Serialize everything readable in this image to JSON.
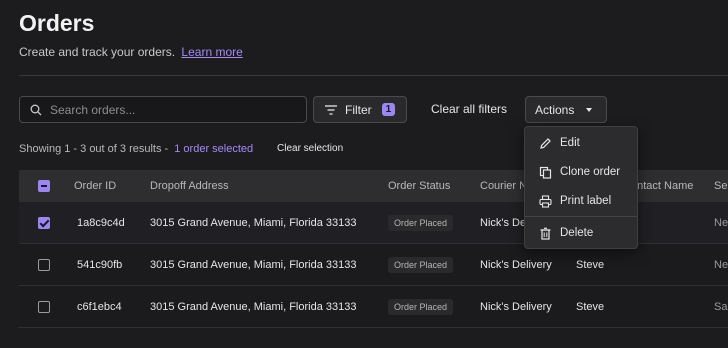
{
  "page": {
    "title": "Orders",
    "subtitle": "Create and track your orders.",
    "learn_more": "Learn more"
  },
  "toolbar": {
    "search_placeholder": "Search orders...",
    "filter_label": "Filter",
    "filter_count": "1",
    "clear_filters": "Clear all filters",
    "actions_label": "Actions"
  },
  "results": {
    "showing": "Showing 1 - 3 out of 3 results -",
    "selected": "1 order selected",
    "clear_selection": "Clear selection"
  },
  "table": {
    "headers": [
      "Order ID",
      "Dropoff Address",
      "Order Status",
      "Courier N",
      "ontact Name",
      "Se"
    ],
    "rows": [
      {
        "selected": true,
        "id": "1a8c9c4d",
        "address": "3015 Grand Avenue, Miami, Florida 33133",
        "status": "Order Placed",
        "courier": "Nick's De",
        "contact": "",
        "extra": "Ne"
      },
      {
        "selected": false,
        "id": "541c90fb",
        "address": "3015 Grand Avenue, Miami, Florida 33133",
        "status": "Order Placed",
        "courier": "Nick's Delivery",
        "contact": "Steve",
        "extra": "Ne"
      },
      {
        "selected": false,
        "id": "c6f1ebc4",
        "address": "3015 Grand Avenue, Miami, Florida 33133",
        "status": "Order Placed",
        "courier": "Nick's Delivery",
        "contact": "Steve",
        "extra": "Sa"
      }
    ]
  },
  "actions_menu": {
    "items": [
      {
        "label": "Edit",
        "icon": "pencil-icon"
      },
      {
        "label": "Clone order",
        "icon": "copy-icon"
      },
      {
        "label": "Print label",
        "icon": "printer-icon"
      },
      {
        "label": "Delete",
        "icon": "trash-icon"
      }
    ]
  },
  "colors": {
    "accent": "#9c86f0",
    "background": "#1c1c1e",
    "header_row": "#2e2e31"
  }
}
